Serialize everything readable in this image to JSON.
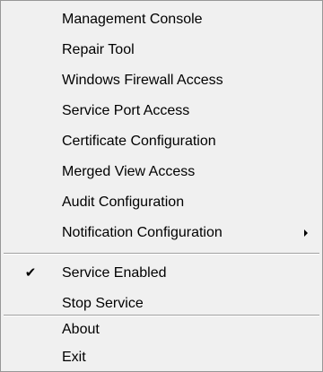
{
  "menu": {
    "items": [
      {
        "label": "Management Console"
      },
      {
        "label": "Repair Tool"
      },
      {
        "label": "Windows Firewall Access"
      },
      {
        "label": "Service Port Access"
      },
      {
        "label": "Certificate Configuration"
      },
      {
        "label": "Merged View Access"
      },
      {
        "label": "Audit Configuration"
      },
      {
        "label": "Notification Configuration",
        "submenu_icon": "submenu-arrow-icon"
      },
      {
        "label": "Service Enabled",
        "checked": true,
        "check_icon": "checkmark-icon"
      },
      {
        "label": "Stop Service"
      },
      {
        "label": "About"
      },
      {
        "label": "Exit"
      }
    ]
  }
}
